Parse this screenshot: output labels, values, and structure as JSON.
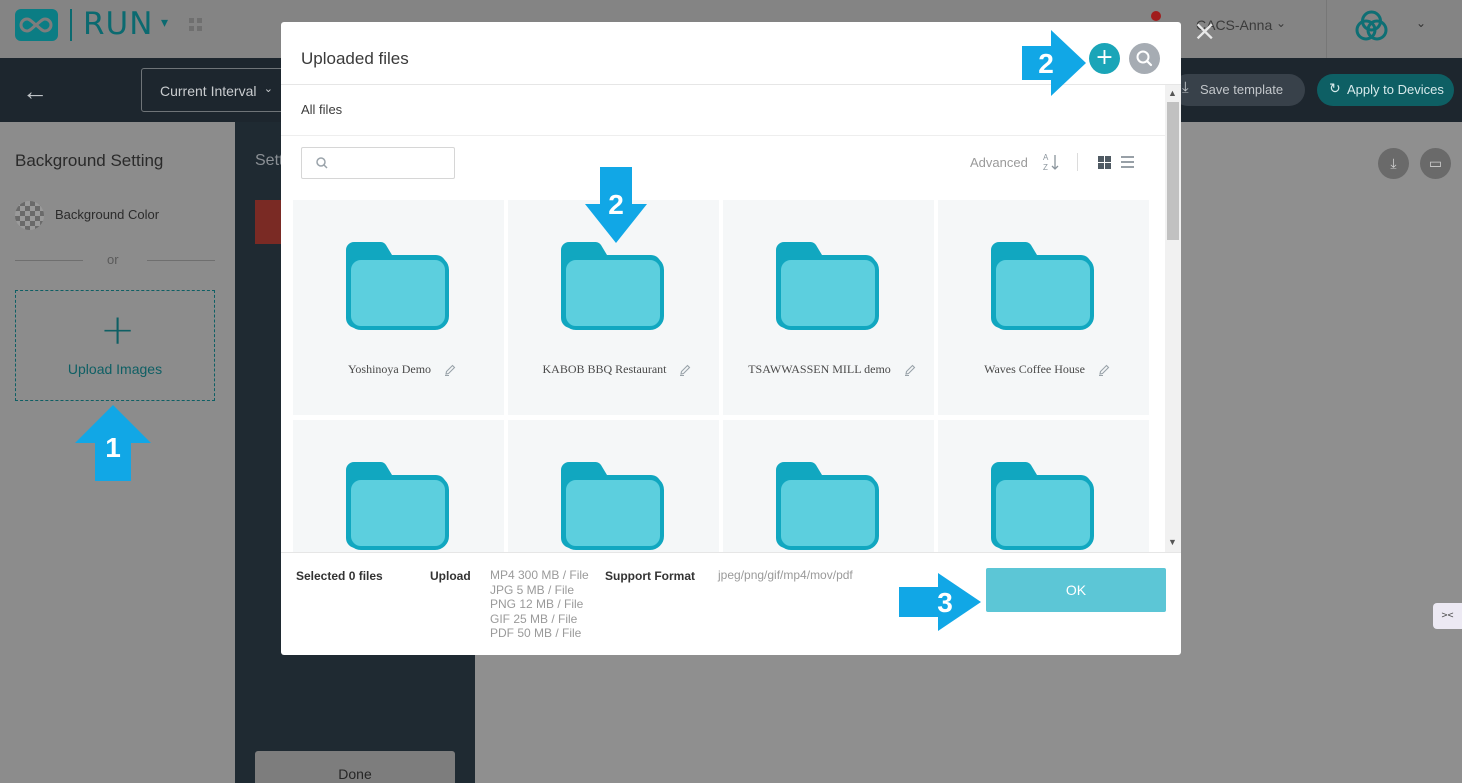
{
  "app": {
    "logo_text": "RUN",
    "user_name": "CACS-Anna",
    "brand_color": "#1aa5b8"
  },
  "toolbar": {
    "interval_value": "Current Interval",
    "save_template_label": "Save template",
    "apply_devices_label": "Apply to Devices"
  },
  "left_panel": {
    "title": "Background Setting",
    "bg_color_label": "Background Color",
    "or_label": "or",
    "upload_plus": "+",
    "upload_label": "Upload Images"
  },
  "mid_panel": {
    "title": "Sett",
    "done_label": "Done"
  },
  "modal": {
    "title": "Uploaded files",
    "breadcrumb": "All files",
    "advanced_label": "Advanced",
    "add_symbol": "+",
    "close_symbol": "×",
    "folders": [
      {
        "name": "Yoshinoya Demo"
      },
      {
        "name": "KABOB BBQ Restaurant"
      },
      {
        "name": "TSAWWASSEN MILL demo"
      },
      {
        "name": "Waves Coffee House"
      },
      {
        "name": ""
      },
      {
        "name": ""
      },
      {
        "name": ""
      },
      {
        "name": ""
      }
    ],
    "footer": {
      "selected": "Selected 0 files",
      "upload_label": "Upload",
      "limits": [
        "MP4 300 MB / File",
        "JPG 5 MB / File",
        "PNG 12 MB / File",
        "GIF 25 MB / File",
        "PDF 50 MB / File"
      ],
      "support_label": "Support Format",
      "formats": "jpeg/png/gif/mp4/mov/pdf",
      "ok_label": "OK"
    }
  },
  "tutorial": {
    "arrow_color": "#11a7e6",
    "steps": [
      "1",
      "2",
      "2",
      "3"
    ]
  }
}
